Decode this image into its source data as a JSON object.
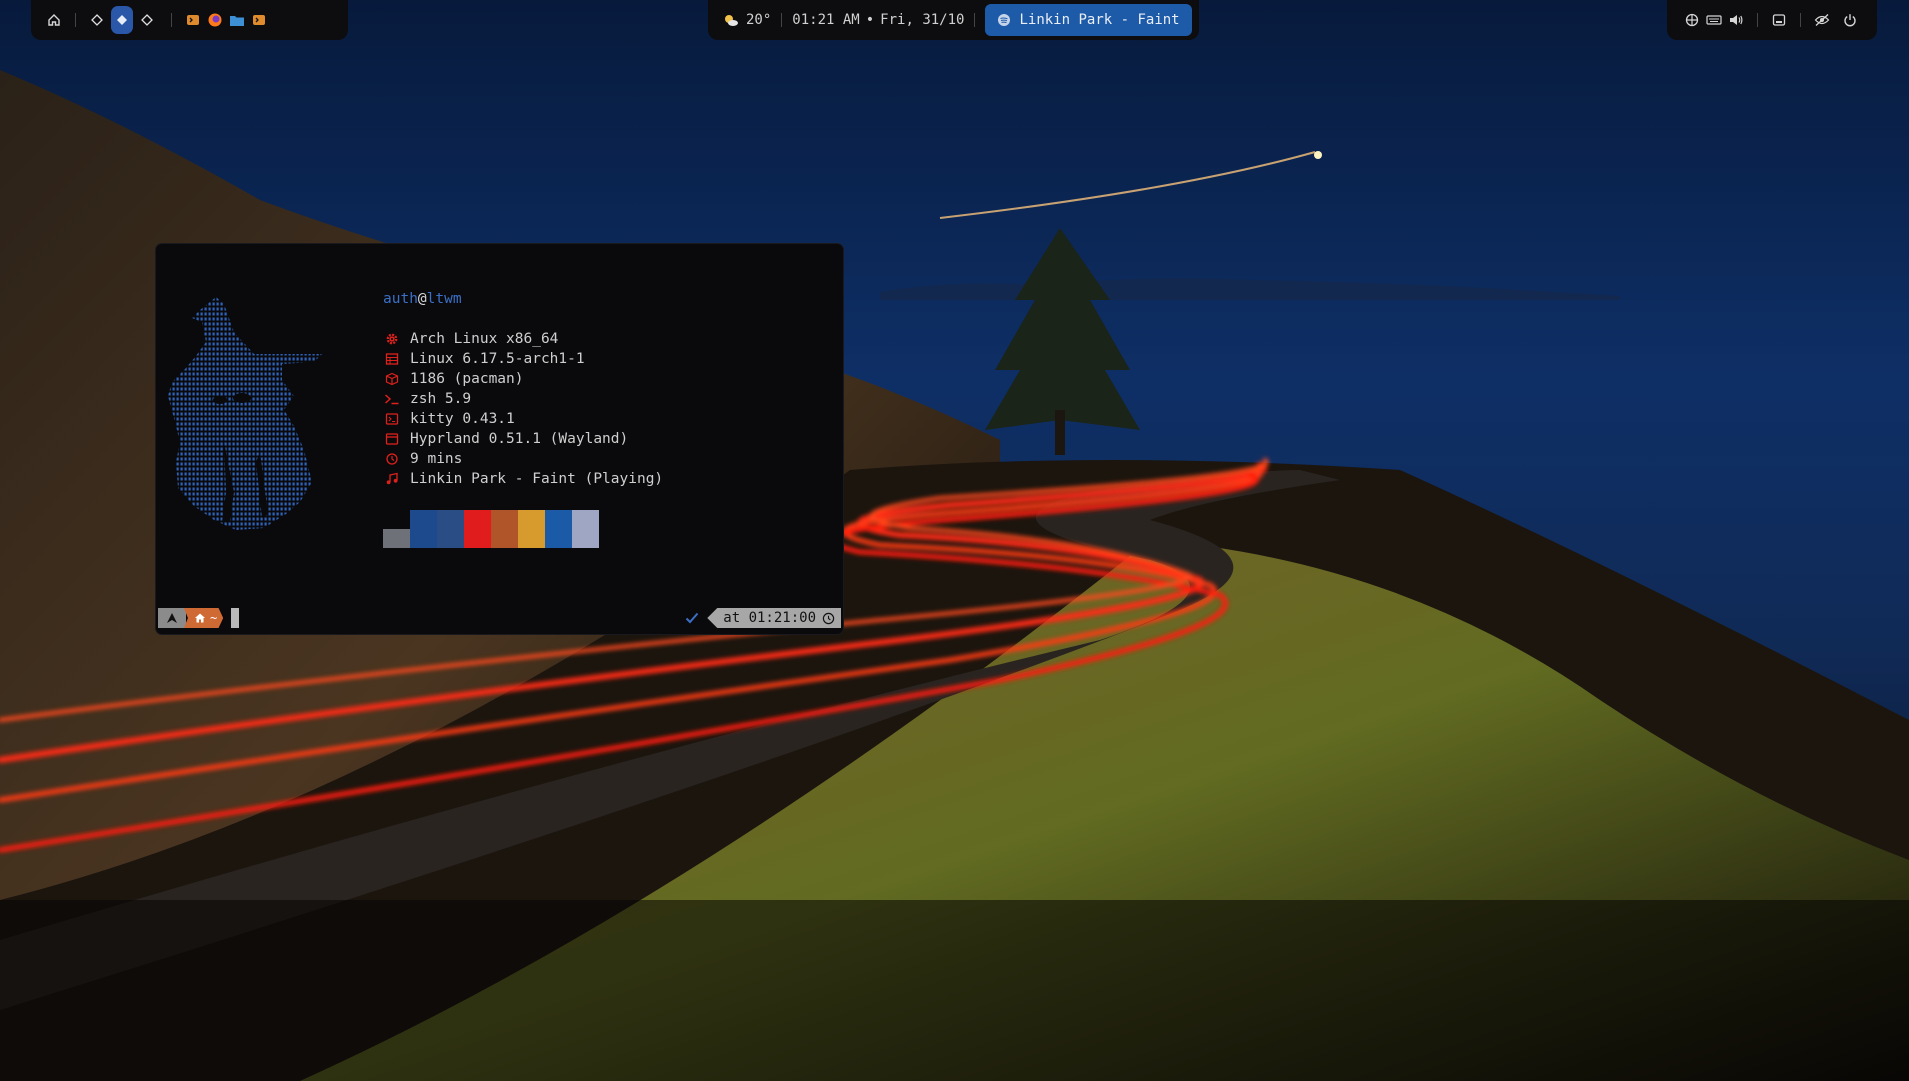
{
  "colors": {
    "bar_bg": "#0d0d0f",
    "accent": "#2b57a8",
    "music_bg": "#1d5aa8",
    "info_icon": "#e0201c",
    "terminal_bg": "#0a0a0c"
  },
  "topbar": {
    "left": {
      "icons": [
        "home-icon",
        "workspace-icon",
        "workspace-icon",
        "workspace-icon",
        "terminal-icon",
        "firefox-icon",
        "files-icon",
        "terminal-icon"
      ],
      "active_workspace": 2
    },
    "center": {
      "weather_icon": "sun-cloud-icon",
      "weather": "20°",
      "time": "01:21 AM",
      "bullet": "•",
      "date": "Fri, 31/10",
      "music_icon": "spotify-icon",
      "music": "Linkin Park - Faint"
    },
    "right": {
      "icons": [
        "network-icon",
        "keyboard-icon",
        "volume-icon",
        "screen-icon",
        "eye-off-icon",
        "power-icon"
      ]
    }
  },
  "terminal": {
    "user": "auth",
    "at": "@",
    "host": "ltwm",
    "info": [
      {
        "icon": "gear-icon",
        "text": "Arch Linux x86_64"
      },
      {
        "icon": "kernel-icon",
        "text": "Linux 6.17.5-arch1-1"
      },
      {
        "icon": "package-icon",
        "text": "1186 (pacman)"
      },
      {
        "icon": "shell-icon",
        "text": "zsh 5.9"
      },
      {
        "icon": "terminal-icon",
        "text": "kitty 0.43.1"
      },
      {
        "icon": "window-icon",
        "text": "Hyprland 0.51.1 (Wayland)"
      },
      {
        "icon": "clock-icon",
        "text": "9 mins"
      },
      {
        "icon": "music-icon",
        "text": "Linkin Park - Faint (Playing)"
      }
    ],
    "swatches": [
      "#6f7178",
      "#1c4a8c",
      "#2a4d86",
      "#e01c1c",
      "#b0552a",
      "#d79a2c",
      "#1a5aa6",
      "#9ea6c4"
    ],
    "prompt": {
      "os_icon": "arch-icon",
      "dir_icon": "home-icon",
      "dir": "~",
      "status_icon": "check-icon",
      "time": "at 01:21:00",
      "time_icon": "clock-icon"
    }
  }
}
